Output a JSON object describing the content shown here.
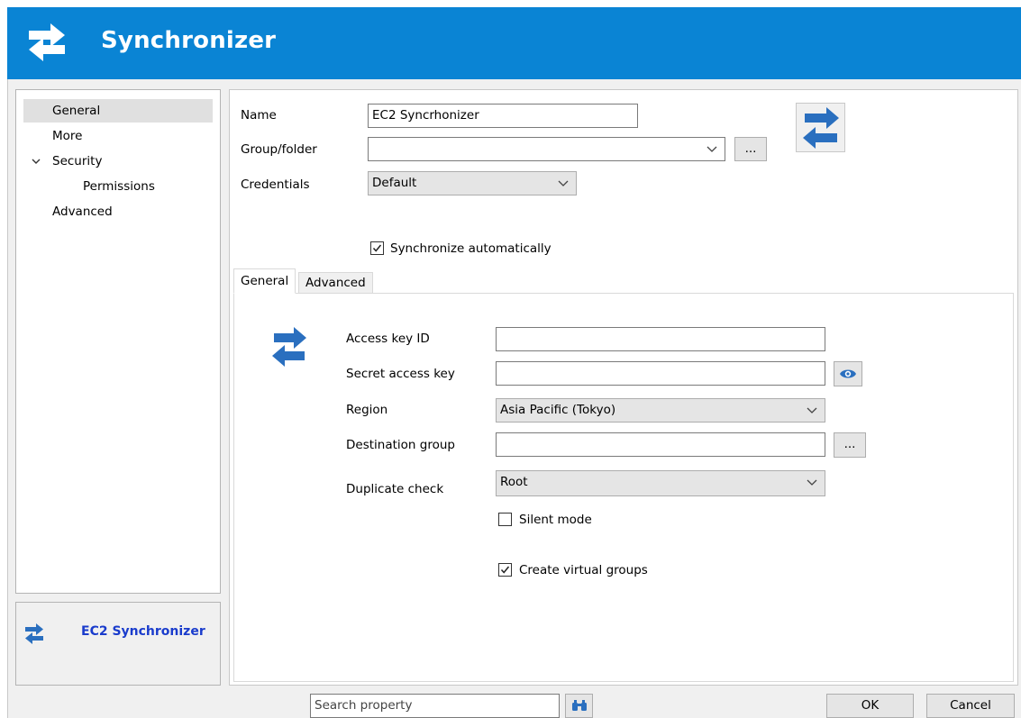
{
  "window": {
    "title": "Synchronizer"
  },
  "nav": {
    "items": [
      {
        "label": "General"
      },
      {
        "label": "More"
      },
      {
        "label": "Security"
      },
      {
        "label": "Permissions"
      },
      {
        "label": "Advanced"
      }
    ]
  },
  "info": {
    "name": "EC2 Synchronizer"
  },
  "form": {
    "name_label": "Name",
    "name_value": "EC2 Syncrhonizer",
    "group_label": "Group/folder",
    "group_value": "",
    "group_browse": "...",
    "credentials_label": "Credentials",
    "credentials_value": "Default",
    "sync_auto_label": "Synchronize automatically",
    "sync_auto_checked": true
  },
  "tabs": [
    {
      "label": "General"
    },
    {
      "label": "Advanced"
    }
  ],
  "tab_general": {
    "access_key_label": "Access key ID",
    "access_key_value": "",
    "secret_key_label": "Secret access key",
    "secret_key_value": "",
    "region_label": "Region",
    "region_value": "Asia Pacific (Tokyo)",
    "dest_group_label": "Destination group",
    "dest_group_value": "",
    "dest_group_browse": "...",
    "duplicate_label": "Duplicate check",
    "duplicate_value": "Root",
    "silent_label": "Silent mode",
    "silent_checked": false,
    "virtual_label": "Create virtual groups",
    "virtual_checked": true
  },
  "footer": {
    "search_placeholder": "Search property",
    "ok_label": "OK",
    "cancel_label": "Cancel"
  },
  "colors": {
    "titlebar": "#0a84d4",
    "icon_blue": "#2a6fbf",
    "info_name": "#1a3ccc"
  }
}
